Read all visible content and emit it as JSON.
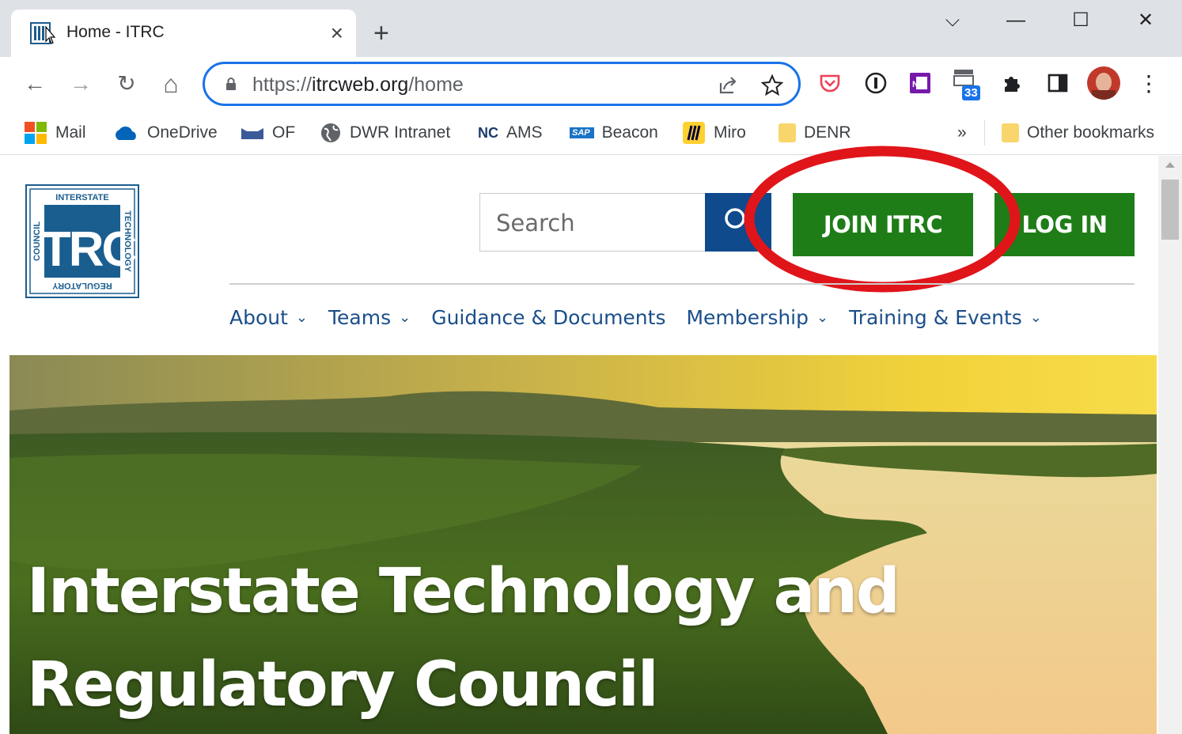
{
  "browser": {
    "tab": {
      "title": "Home - ITRC",
      "close": "×"
    },
    "new_tab": "+",
    "window_controls": {
      "tab_search": "⌵",
      "minimize": "—",
      "maximize": "☐",
      "close": "✕"
    },
    "nav": {
      "back": "←",
      "forward": "→",
      "reload": "↻",
      "home": "⌂"
    },
    "omnibox": {
      "protocol": "https://",
      "host": "itrcweb.org",
      "path": "/home"
    },
    "extension_badge": "33",
    "menu": "⋮",
    "bookmarks": [
      {
        "label": "Mail",
        "icon": "windows-icon"
      },
      {
        "label": "OneDrive",
        "icon": "onedrive-cloud-icon"
      },
      {
        "label": "OF",
        "icon": "of-icon"
      },
      {
        "label": "DWR Intranet",
        "icon": "globe-icon"
      },
      {
        "label": "AMS",
        "icon": "nc-icon",
        "icon_text": "NC"
      },
      {
        "label": "Beacon",
        "icon": "sap-icon",
        "icon_text": "SAP"
      },
      {
        "label": "Miro",
        "icon": "miro-icon"
      },
      {
        "label": "DENR",
        "icon": "folder-icon"
      }
    ],
    "bookmarks_overflow": "»",
    "other_bookmarks": "Other bookmarks"
  },
  "site": {
    "logo": {
      "top": "INTERSTATE",
      "center": "ITRC",
      "left": "COUNCIL",
      "right": "TECHNOLOGY",
      "bottom": "REGULATORY"
    },
    "search_placeholder": "Search",
    "join_button": "JOIN ITRC",
    "login_button": "LOG IN",
    "nav": [
      {
        "label": "About",
        "has_dropdown": true
      },
      {
        "label": "Teams",
        "has_dropdown": true
      },
      {
        "label": "Guidance & Documents",
        "has_dropdown": false
      },
      {
        "label": "Membership",
        "has_dropdown": true
      },
      {
        "label": "Training & Events",
        "has_dropdown": true
      }
    ],
    "hero": {
      "line1": "Interstate Technology and",
      "line2": "Regulatory Council"
    }
  },
  "colors": {
    "brand_green": "#1e7d16",
    "brand_navy": "#0e4a8c",
    "nav_text": "#1b4f8a",
    "annotation_red": "#e0151a",
    "omnibox_focus": "#1a73e8"
  }
}
